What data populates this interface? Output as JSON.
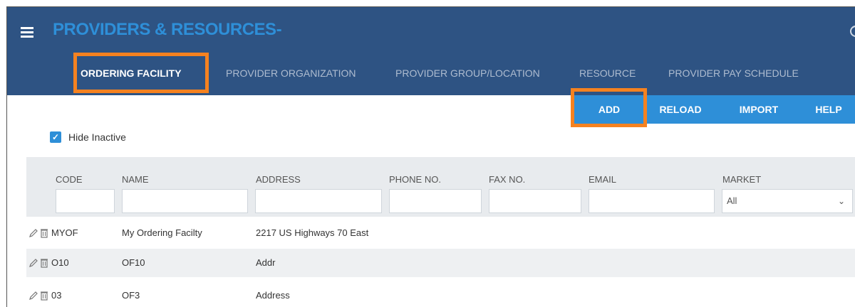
{
  "app": {
    "title": "PROVIDERS & RESOURCES",
    "title_suffix": "-"
  },
  "tabs": [
    {
      "label": "ORDERING FACILITY",
      "active": true
    },
    {
      "label": "PROVIDER ORGANIZATION",
      "active": false
    },
    {
      "label": "PROVIDER GROUP/LOCATION",
      "active": false
    },
    {
      "label": "RESOURCE",
      "active": false
    },
    {
      "label": "PROVIDER PAY SCHEDULE",
      "active": false
    }
  ],
  "toolbar": {
    "add_label": "ADD",
    "reload_label": "RELOAD",
    "import_label": "IMPORT",
    "help_label": "HELP"
  },
  "filters": {
    "hide_inactive_label": "Hide Inactive",
    "hide_inactive_checked": true
  },
  "grid": {
    "columns": [
      "CODE",
      "NAME",
      "ADDRESS",
      "PHONE NO.",
      "FAX NO.",
      "EMAIL",
      "MARKET"
    ],
    "market_selected": "All",
    "rows": [
      {
        "code": "MYOF",
        "name": "My Ordering Facilty",
        "address": "2217 US Highways 70 East"
      },
      {
        "code": "O10",
        "name": "OF10",
        "address": "Addr"
      },
      {
        "code": "03",
        "name": "OF3",
        "address": "Address"
      }
    ]
  },
  "colors": {
    "header_bg": "#2e5383",
    "accent": "#2e8fd8",
    "highlight": "#f58220"
  },
  "icons": {
    "menu": "hamburger-icon",
    "edit": "pencil-icon",
    "delete": "trash-icon",
    "dropdown": "chevron-down-icon"
  }
}
